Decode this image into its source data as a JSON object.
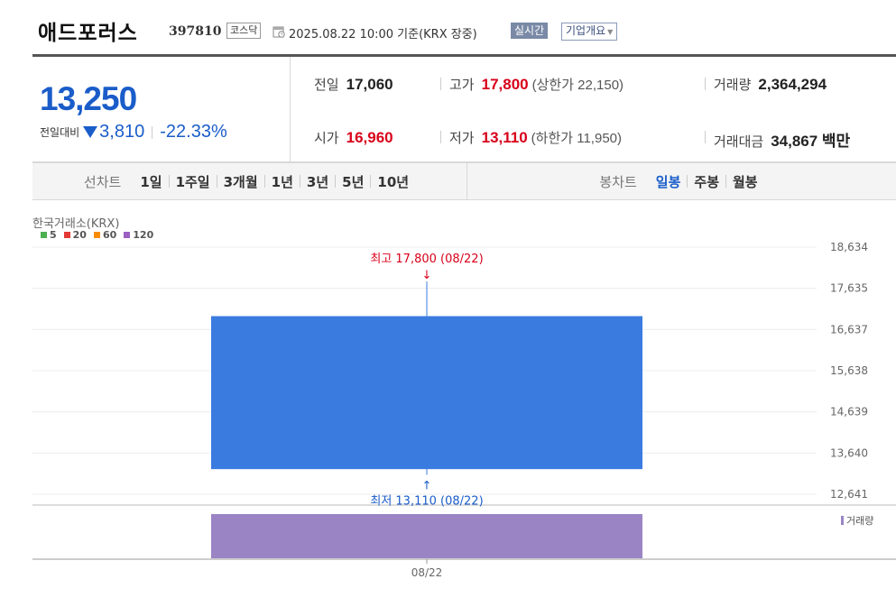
{
  "header": {
    "company_name": "애드포러스",
    "code": "397810",
    "market": "코스닥",
    "timestamp": "2025.08.22 10:00  기준(KRX 장중)",
    "realtime_label": "실시간",
    "company_overview_label": "기업개요"
  },
  "summary": {
    "current_price": "13,250",
    "change_label": "전일대비",
    "change_amount": "3,810",
    "change_percent": "-22.33%",
    "prev_close": {
      "label": "전일",
      "value": "17,060"
    },
    "open": {
      "label": "시가",
      "value": "16,960"
    },
    "high": {
      "label": "고가",
      "value": "17,800",
      "note": "(상한가 22,150)"
    },
    "low": {
      "label": "저가",
      "value": "13,110",
      "note": "(하한가 11,950)"
    },
    "volume": {
      "label": "거래량",
      "value": "2,364,294"
    },
    "trade_value": {
      "label": "거래대금",
      "value": "34,867 백만"
    }
  },
  "period_bar": {
    "line_chart_label": "선차트",
    "line_periods": [
      "1일",
      "1주일",
      "3개월",
      "1년",
      "3년",
      "5년",
      "10년"
    ],
    "candle_chart_label": "봉차트",
    "candle_periods": [
      "일봉",
      "주봉",
      "월봉"
    ],
    "active_candle": "일봉"
  },
  "chart": {
    "source": "한국거래소(KRX)",
    "ma_legend": [
      {
        "label": "5",
        "color": "#4caf50"
      },
      {
        "label": "20",
        "color": "#e53935"
      },
      {
        "label": "60",
        "color": "#fb8c00"
      },
      {
        "label": "120",
        "color": "#9c5fc2"
      }
    ],
    "volume_label": "거래량",
    "high_annotation": "최고 17,800 (08/22)",
    "low_annotation": "최저 13,110 (08/22)",
    "colors": {
      "down_candle": "#3a7be0",
      "volume_bar": "#9a84c4",
      "high_text": "#d8001a",
      "low_text": "#1a5dc9"
    }
  },
  "chart_data": {
    "type": "candlestick",
    "x": [
      "08/22"
    ],
    "open": [
      16960
    ],
    "high": [
      17800
    ],
    "low": [
      13110
    ],
    "close": [
      13250
    ],
    "volume": [
      2364294
    ],
    "ylim": [
      12641,
      18634
    ],
    "yticks": [
      "18,634",
      "17,635",
      "16,637",
      "15,638",
      "14,639",
      "13,640",
      "12,641"
    ],
    "ytick_values": [
      18634,
      17635,
      16637,
      15638,
      14639,
      13640,
      12641
    ],
    "xticks": [
      "08/22"
    ]
  }
}
